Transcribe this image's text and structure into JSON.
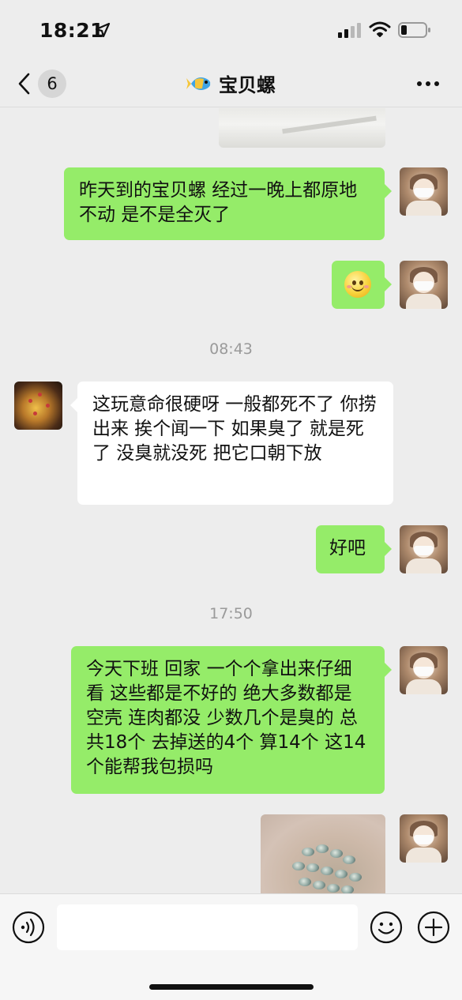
{
  "status_bar": {
    "time": "18:21",
    "icons": [
      "location-arrow-icon",
      "signal-icon",
      "wifi-icon",
      "battery-icon"
    ]
  },
  "nav": {
    "back_icon": "chevron-left-icon",
    "unread_count": "6",
    "title_icon": "tropical-fish-icon",
    "title": "宝贝螺",
    "more_icon": "ellipsis-icon"
  },
  "messages": [
    {
      "from": "me",
      "type": "image",
      "description_icon": "photo"
    },
    {
      "from": "me",
      "type": "text",
      "text": "昨天到的宝贝螺 经过一晚上都原地不动 是不是全灭了"
    },
    {
      "from": "me",
      "type": "emoji",
      "icon": "smiling-emoji-icon"
    },
    {
      "type": "timestamp",
      "text": "08:43"
    },
    {
      "from": "other",
      "type": "text",
      "text": "这玩意命很硬呀 一般都死不了 你捞出来 挨个闻一下  如果臭了 就是死了  没臭就没死  把它口朝下放"
    },
    {
      "from": "me",
      "type": "text",
      "text": "好吧"
    },
    {
      "type": "timestamp",
      "text": "17:50"
    },
    {
      "from": "me",
      "type": "text",
      "text": "今天下班 回家 一个个拿出来仔细看 这些都是不好的 绝大多数都是空壳 连肉都没 少数几个是臭的 总共18个 去掉送的4个 算14个 这14个能帮我包损吗"
    },
    {
      "from": "me",
      "type": "image",
      "description_icon": "photo"
    }
  ],
  "input_bar": {
    "voice_icon": "voice-icon",
    "input_value": "",
    "emoji_icon": "smiley-icon",
    "plus_icon": "plus-icon"
  },
  "colors": {
    "background": "#ededed",
    "my_bubble": "#95ec69",
    "other_bubble": "#ffffff",
    "timestamp": "#9a9a9a"
  }
}
